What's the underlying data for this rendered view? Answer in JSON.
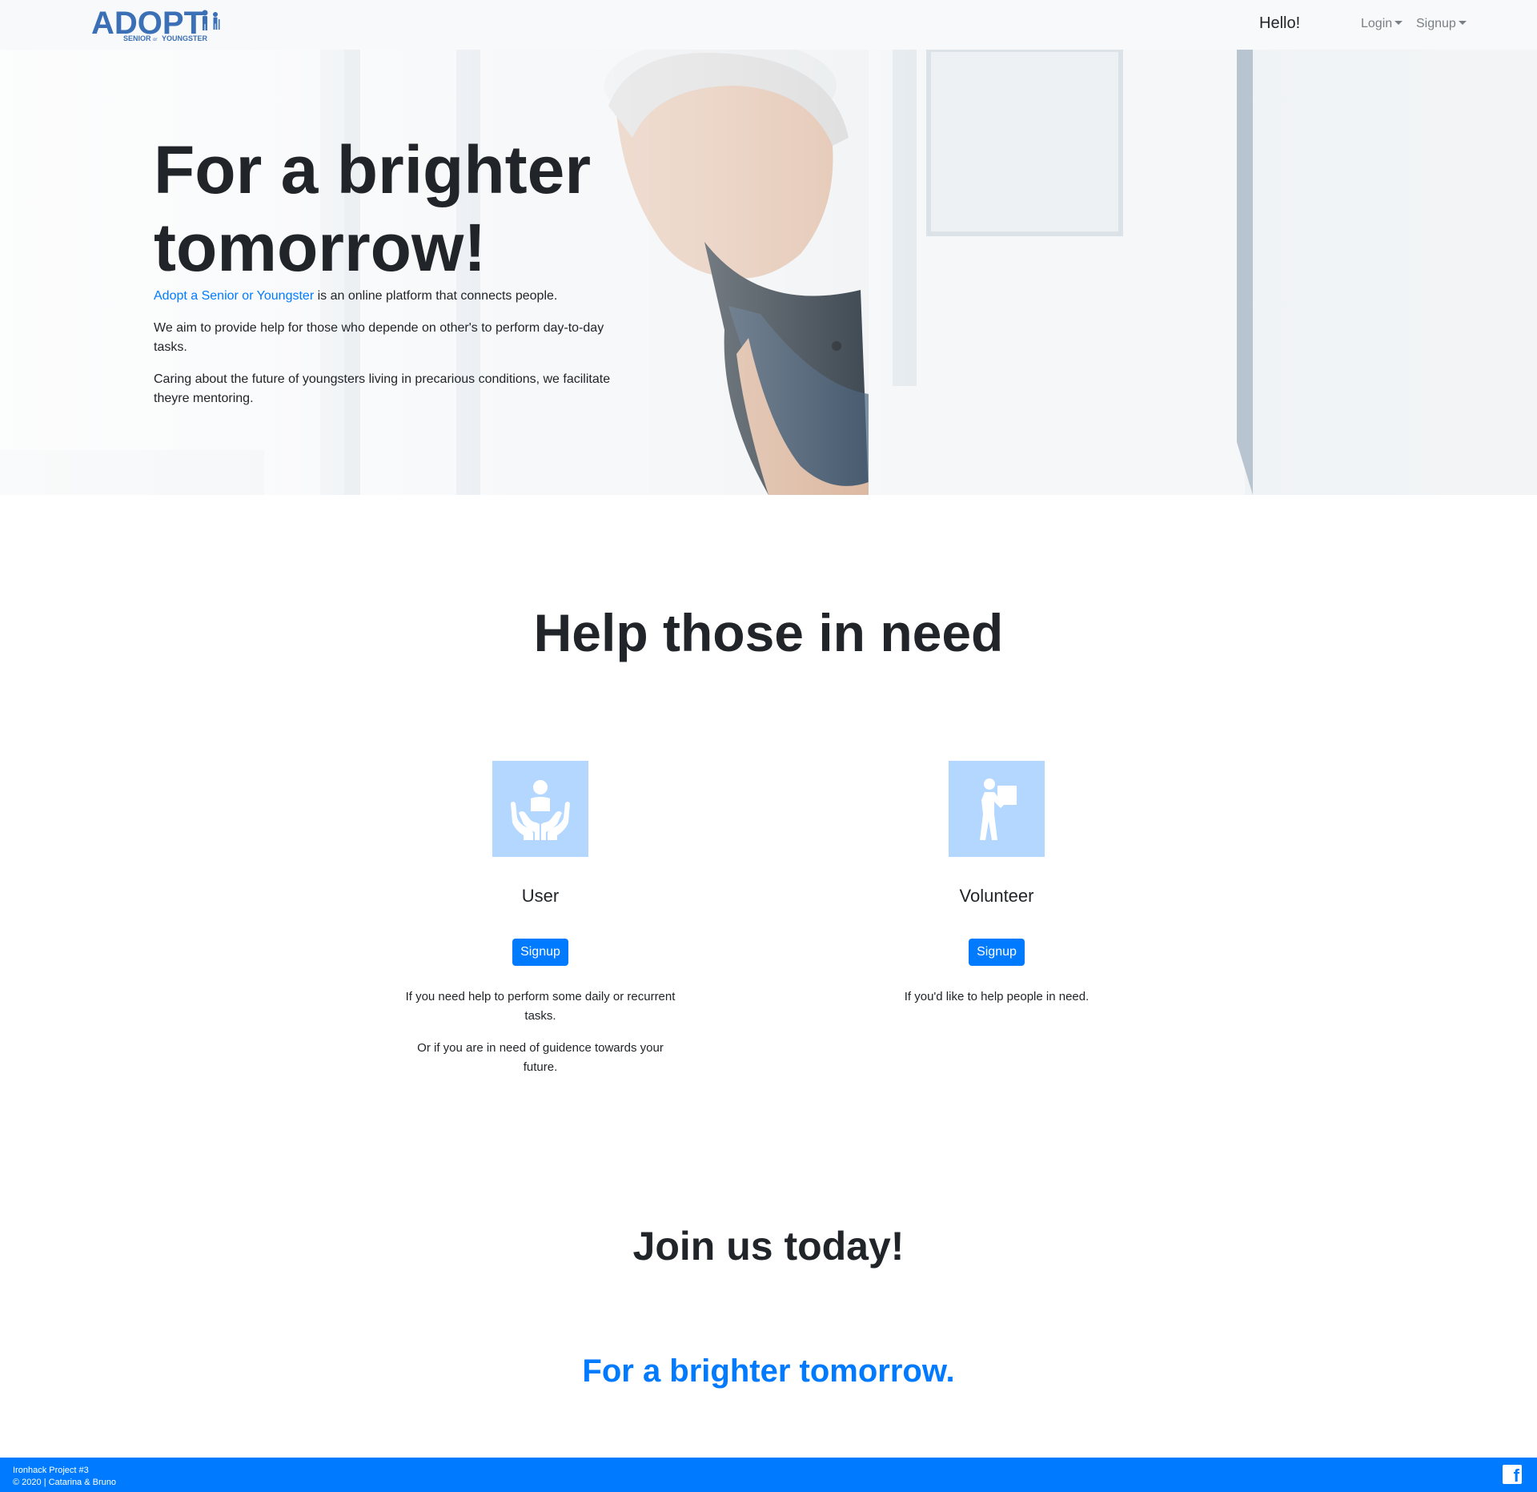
{
  "navbar": {
    "logo_main": "ADOPT",
    "logo_sub_left": "SENIOR",
    "logo_sub_mid": "or",
    "logo_sub_right": "YOUNGSTER",
    "greeting": "Hello!",
    "login_label": "Login",
    "signup_label": "Signup"
  },
  "hero": {
    "title": "For a brighter tomorrow!",
    "intro_link": "Adopt a Senior or Youngster",
    "intro_rest": " is an online platform that connects people.",
    "para2": "We aim to provide help for those who depende on other's to perform day-to-day tasks.",
    "para3": "Caring about the future of youngsters living in precarious conditions, we facilitate theyre mentoring."
  },
  "help": {
    "title": "Help those in need",
    "cards": [
      {
        "icon": "hands-holding-person-icon",
        "name": "User",
        "button": "Signup",
        "desc1": "If you need help to perform some daily or recurrent tasks.",
        "desc2": "Or if you are in need of guidence towards your future."
      },
      {
        "icon": "person-carrying-box-icon",
        "name": "Volunteer",
        "button": "Signup",
        "desc1": "If you'd like to help people in need."
      }
    ]
  },
  "join": {
    "title": "Join us today!",
    "tagline": "For a brighter tomorrow."
  },
  "footer": {
    "line1": "Ironhack Project #3",
    "line2": "© 2020 | Catarina & Bruno",
    "social_icon": "facebook-icon",
    "social_glyph": "f"
  },
  "colors": {
    "primary": "#007bff",
    "navbar_bg": "#f8f9fa",
    "icon_tile": "#b3d7ff",
    "logo_blue": "#3b6fb6"
  }
}
